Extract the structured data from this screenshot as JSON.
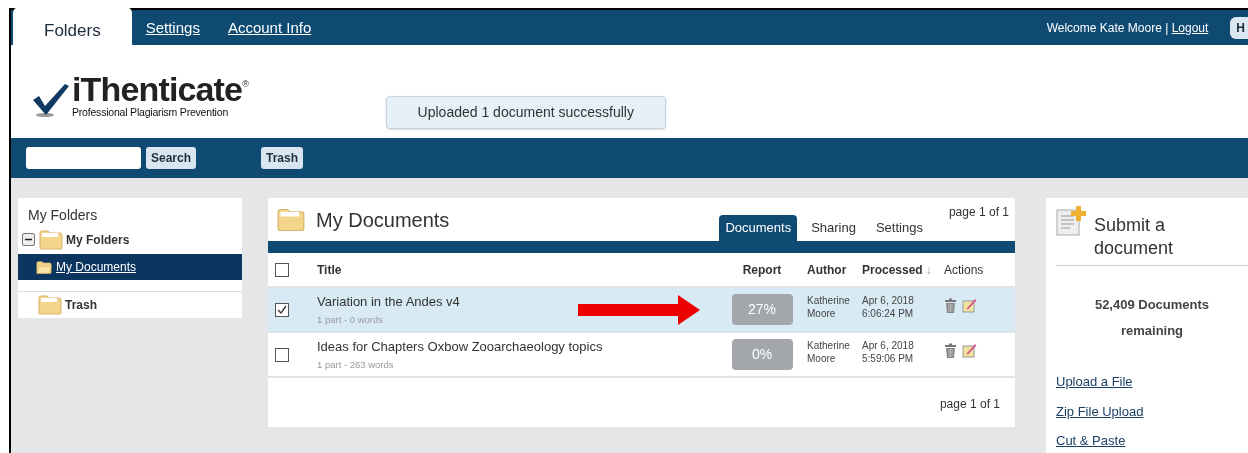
{
  "nav": {
    "tabs": [
      {
        "label": "Folders",
        "selected": true
      },
      {
        "label": "Settings",
        "selected": false
      },
      {
        "label": "Account Info",
        "selected": false
      }
    ],
    "welcome": "Welcome Kate Moore |",
    "logout": "Logout",
    "help": "H"
  },
  "logo": {
    "name": "iThenticate",
    "mark": "®",
    "tagline": "Professional Plagiarism Prevention"
  },
  "toast": "Uploaded 1 document successfully",
  "toolbar": {
    "search_button": "Search",
    "trash_button": "Trash"
  },
  "sidebar": {
    "title": "My Folders",
    "tree": [
      {
        "label": "My Folders",
        "expanded": true,
        "children": [
          {
            "label": "My Documents",
            "selected": true
          }
        ]
      }
    ],
    "trash": "Trash"
  },
  "documents": {
    "title": "My Documents",
    "page_top": "page 1 of 1",
    "page_bottom": "page 1 of 1",
    "tabs": [
      {
        "label": "Documents",
        "selected": true
      },
      {
        "label": "Sharing",
        "selected": false
      },
      {
        "label": "Settings",
        "selected": false
      }
    ],
    "select_all_checked": false,
    "columns": [
      {
        "label": "Title"
      },
      {
        "label": "Report"
      },
      {
        "label": "Author"
      },
      {
        "label": "Processed",
        "sort_mark": "↓"
      },
      {
        "label": "Actions"
      }
    ],
    "rows": [
      {
        "selected": true,
        "marked": true,
        "title": "Variation in the Andes v4",
        "meta": "1 part - 0 words",
        "report": "27%",
        "author": "Katherine Moore",
        "date": "Apr 6, 2018",
        "time": "6:06:24 PM"
      },
      {
        "selected": false,
        "marked": false,
        "title": "Ideas for Chapters Oxbow Zooarchaeology topics",
        "meta": "1 part - 263 words",
        "report": "0%",
        "author": "Katherine Moore",
        "date": "Apr 6, 2018",
        "time": "5:59:06 PM"
      }
    ]
  },
  "submit": {
    "title": "Submit a document",
    "remaining": "52,409 Documents remaining",
    "links": [
      "Upload a File",
      "Zip File Upload",
      "Cut & Paste"
    ]
  }
}
